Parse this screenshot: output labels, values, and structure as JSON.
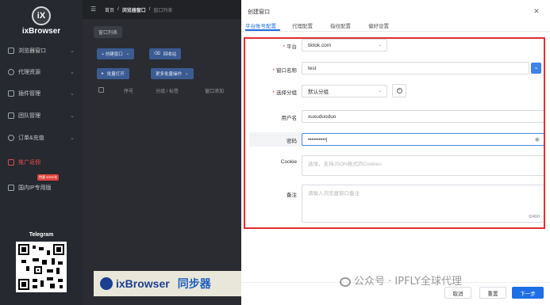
{
  "app": {
    "name": "ixBrowser",
    "logo_glyph": "iX"
  },
  "sidebar": {
    "items": [
      {
        "label": "浏览器窗口",
        "icon": "window-icon"
      },
      {
        "label": "代理资源",
        "icon": "globe-icon"
      },
      {
        "label": "插件管理",
        "icon": "puzzle-icon"
      },
      {
        "label": "团队管理",
        "icon": "users-icon"
      },
      {
        "label": "订单&充值",
        "icon": "coin-icon"
      },
      {
        "label": "推广返佣",
        "icon": "gift-icon"
      },
      {
        "label": "国内IP专用版",
        "icon": "external-icon"
      }
    ],
    "promo_badge": "特惠 ¥399/年",
    "telegram_label": "Telegram"
  },
  "breadcrumb": {
    "home": "首页",
    "sep": "/",
    "section": "浏览器窗口",
    "page": "窗口列表"
  },
  "main": {
    "tab_chip": "窗口列表",
    "create_button": "+ 创建窗口",
    "group_button": "回收站",
    "batch_open": "批量打开",
    "batch_more": "更多批量操作",
    "columns": [
      "序号",
      "分组 / 标签",
      "窗口添加"
    ],
    "banner_text": "ixBrowser",
    "banner_text2": "同步器"
  },
  "dialog": {
    "title": "创建窗口",
    "tabs": [
      "平台账号配置",
      "代理配置",
      "指纹配置",
      "偏好设置"
    ],
    "active_tab": 0,
    "fields": {
      "platform": {
        "label": "平台",
        "value": "tiktok.com",
        "required": true
      },
      "window_name": {
        "label": "窗口名称",
        "value": "test",
        "required": true
      },
      "group": {
        "label": "选择分组",
        "value": "默认分组",
        "required": true
      },
      "username": {
        "label": "用户名",
        "value": "xuxuduoduo"
      },
      "password": {
        "label": "密码",
        "value": "••••••••••|"
      },
      "cookie": {
        "label": "Cookie",
        "placeholder": "选填，支持JSON格式的Cookies"
      },
      "remark": {
        "label": "备注",
        "placeholder": "请输入浏览器窗口备注",
        "counter": "0/400"
      }
    },
    "footer": {
      "cancel": "取消",
      "reset": "重置",
      "next": "下一步"
    }
  },
  "watermark": "公众号 · IPFLY全球代理",
  "colors": {
    "accent": "#1e6fe6",
    "highlight_frame": "#e02f2f",
    "sidebar_bg": "#262930"
  }
}
